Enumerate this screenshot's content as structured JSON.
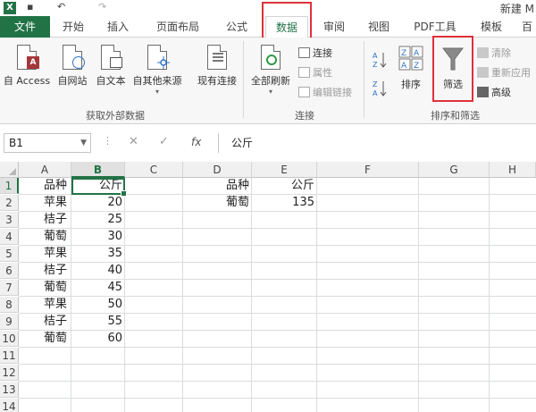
{
  "title_bar": {
    "app_logo": "X",
    "undo_icon": "↶",
    "redo_icon": "↷",
    "title": "新建 M"
  },
  "tabs": [
    "文件",
    "开始",
    "插入",
    "页面布局",
    "公式",
    "数据",
    "审阅",
    "视图",
    "PDF工具",
    "模板",
    "百"
  ],
  "active_tab": "数据",
  "ribbon": {
    "external_data": {
      "access": "自 Access",
      "web": "自网站",
      "text": "自文本",
      "other": "自其他来源",
      "existing": "现有连接",
      "group_label": "获取外部数据"
    },
    "connections": {
      "refresh_all": "全部刷新",
      "connections": "连接",
      "properties": "属性",
      "edit_links": "编辑链接",
      "group_label": "连接"
    },
    "sort_filter": {
      "sort_az": "A→Z",
      "sort_za": "Z→A",
      "sort": "排序",
      "filter": "筛选",
      "clear": "清除",
      "reapply": "重新应用",
      "advanced": "高级",
      "group_label": "排序和筛选"
    }
  },
  "formula_bar": {
    "name_box": "B1",
    "cancel_icon": "✕",
    "enter_icon": "✓",
    "fx_label": "fx",
    "formula": "公斤"
  },
  "sheet": {
    "columns": [
      "A",
      "B",
      "C",
      "D",
      "E",
      "F",
      "G",
      "H"
    ],
    "selected_column": "B",
    "rows": [
      "1",
      "2",
      "3",
      "4",
      "5",
      "6",
      "7",
      "8",
      "9",
      "10",
      "11",
      "12",
      "13",
      "14"
    ],
    "selected_row": "1",
    "table1_header": [
      "品种",
      "公斤"
    ],
    "table1": [
      [
        "苹果",
        "20"
      ],
      [
        "桔子",
        "25"
      ],
      [
        "葡萄",
        "30"
      ],
      [
        "苹果",
        "35"
      ],
      [
        "桔子",
        "40"
      ],
      [
        "葡萄",
        "45"
      ],
      [
        "苹果",
        "50"
      ],
      [
        "桔子",
        "55"
      ],
      [
        "葡萄",
        "60"
      ]
    ],
    "table2_header": [
      "品种",
      "公斤"
    ],
    "table2_row": [
      "葡萄",
      "135"
    ]
  },
  "colors": {
    "excel_green": "#217346",
    "highlight_red": "#e0303a"
  }
}
